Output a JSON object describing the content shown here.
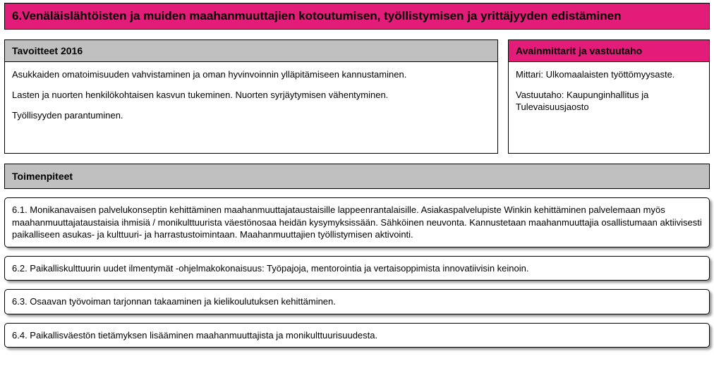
{
  "title": "6.Venäläislähtöisten ja muiden maahanmuuttajien kotoutumisen, työllistymisen ja yrittäjyyden edistäminen",
  "goals": {
    "header": "Tavoitteet 2016",
    "items": [
      "Asukkaiden omatoimisuuden vahvistaminen ja oman hyvinvoinnin ylläpitämiseen kannustaminen.",
      "Lasten ja nuorten henkilökohtaisen kasvun tukeminen. Nuorten syrjäytymisen vähentyminen.",
      "Työllisyyden parantuminen."
    ]
  },
  "metrics": {
    "header": "Avainmittarit ja vastuutaho",
    "items": [
      "Mittari: Ulkomaalaisten työttömyysaste.",
      "Vastuutaho: Kaupunginhallitus ja Tulevaisuusjaosto"
    ]
  },
  "actions": {
    "header": "Toimenpiteet",
    "items": [
      "6.1. Monikanavaisen palvelukonseptin kehittäminen maahanmuuttajataustaisille lappeenrantalaisille. Asiakaspalvelupiste Winkin kehittäminen palvelemaan myös maahanmuuttajataustaisia ihmisiä  / monikulttuurista väestönosaa heidän kysymyksissään. Sähköinen neuvonta. Kannustetaan maahanmuuttajia osallistumaan aktiivisesti paikalliseen asukas- ja kulttuuri- ja harrastustoimintaan. Maahanmuuttajien työllistymisen aktivointi.",
      "6.2. Paikalliskulttuurin uudet ilmentymät -ohjelmakokonaisuus: Työpajoja, mentorointia ja vertaisoppimista innovatiivisin keinoin.",
      "6.3. Osaavan työvoiman tarjonnan takaaminen  ja kielikoulutuksen kehittäminen.",
      "6.4. Paikallisväestön tietämyksen lisääminen maahanmuuttajista ja monikulttuurisuudesta."
    ]
  }
}
